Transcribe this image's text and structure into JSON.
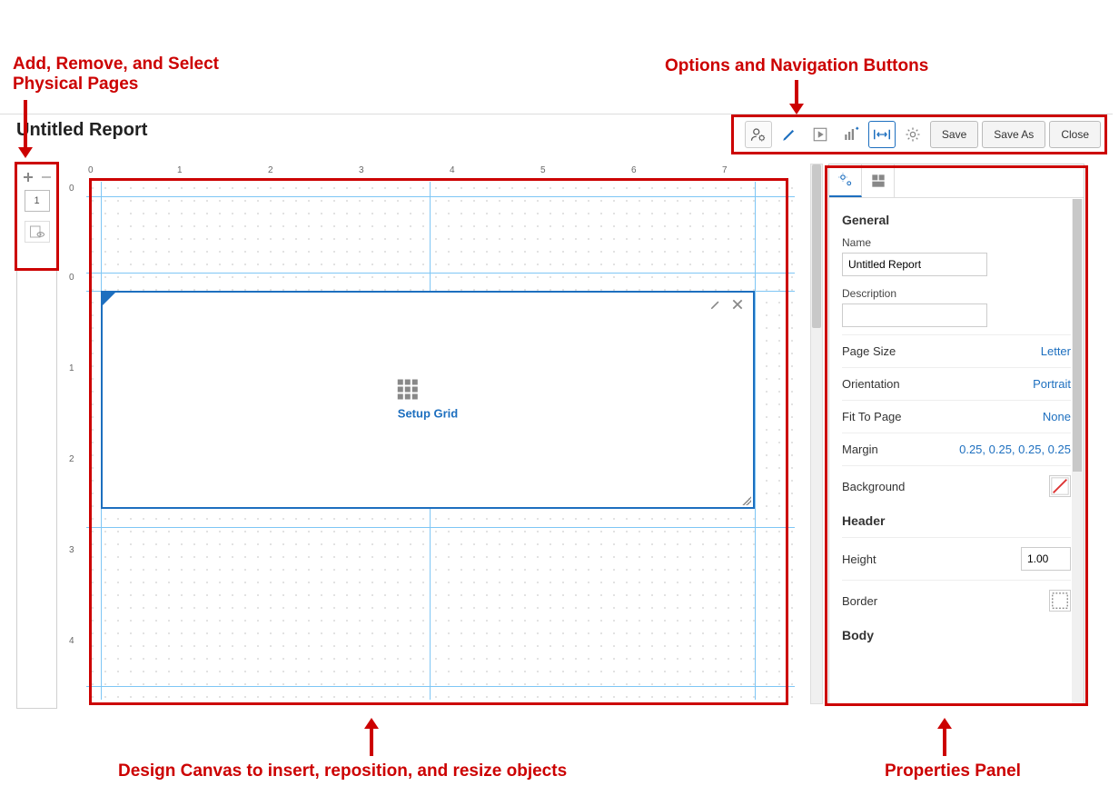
{
  "annotations": {
    "pages_label_line1": "Add, Remove, and Select",
    "pages_label_line2": "Physical Pages",
    "toolbar_label": "Options and Navigation Buttons",
    "canvas_label": "Design Canvas to insert, reposition, and resize objects",
    "props_label": "Properties Panel"
  },
  "title": "Untitled Report",
  "toolbar": {
    "save": "Save",
    "save_as": "Save As",
    "close": "Close"
  },
  "page_panel": {
    "page_number": "1"
  },
  "ruler": {
    "h": [
      "0",
      "1",
      "2",
      "3",
      "4",
      "5",
      "6",
      "7"
    ],
    "v": [
      "0",
      "0",
      "1",
      "2",
      "3",
      "4"
    ]
  },
  "grid_widget": {
    "label": "Setup Grid"
  },
  "properties": {
    "general_header": "General",
    "name_label": "Name",
    "name_value": "Untitled Report",
    "description_label": "Description",
    "description_value": "",
    "page_size_label": "Page Size",
    "page_size_value": "Letter",
    "orientation_label": "Orientation",
    "orientation_value": "Portrait",
    "fit_label": "Fit To Page",
    "fit_value": "None",
    "margin_label": "Margin",
    "margin_value": "0.25, 0.25, 0.25, 0.25",
    "background_label": "Background",
    "header_header": "Header",
    "height_label": "Height",
    "height_value": "1.00",
    "border_label": "Border",
    "body_header": "Body"
  }
}
